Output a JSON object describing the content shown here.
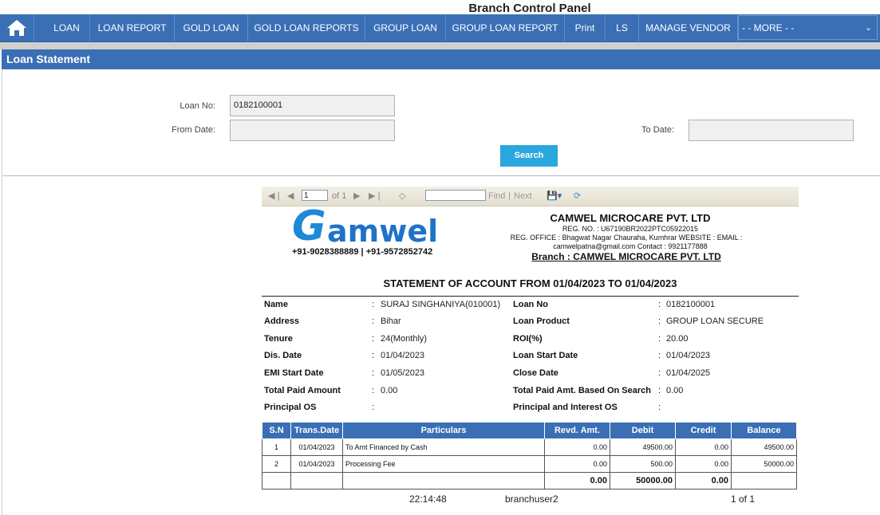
{
  "app": {
    "title": "Branch Control Panel"
  },
  "nav": {
    "items": [
      "LOAN",
      "LOAN REPORT",
      "GOLD LOAN",
      "GOLD LOAN REPORTS",
      "GROUP LOAN",
      "GROUP LOAN REPORT",
      "Print",
      "LS",
      "MANAGE VENDOR"
    ],
    "more": "- - MORE - -"
  },
  "section": {
    "title": "Loan Statement"
  },
  "form": {
    "loan_no_label": "Loan No:",
    "loan_no_value": "0182100001",
    "from_date_label": "From Date:",
    "to_date_label": "To Date:",
    "search_label": "Search"
  },
  "toolbar": {
    "page_value": "1",
    "of_label": "of 1",
    "find_label": "Find",
    "separator": "|",
    "next_label": "Next"
  },
  "report": {
    "logo_initial": "G",
    "logo_rest": "amwel",
    "logo_phone": "+91-9028388889 | +91-9572852742",
    "company": "CAMWEL MICROCARE PVT. LTD",
    "reg_no": "REG. NO. : U67190BR2022PTC05922015",
    "reg_office": "REG. OFFICE : Bhagwat Nagar Chauraha,  Kumhrar WEBSITE :       EMAIL :",
    "email_contact": "camwelpatna@gmail.com     Contact : 9921177888",
    "branch": "Branch : CAMWEL MICROCARE PVT. LTD",
    "statement_title": "STATEMENT OF ACCOUNT FROM 01/04/2023 TO  01/04/2023",
    "info_left": [
      {
        "label": "Name",
        "value": "SURAJ  SINGHANIYA(010001)"
      },
      {
        "label": "Address",
        "value": "Bihar"
      },
      {
        "label": "Tenure",
        "value": "24(Monthly)"
      },
      {
        "label": "Dis. Date",
        "value": "01/04/2023"
      },
      {
        "label": "EMI Start Date",
        "value": "01/05/2023"
      },
      {
        "label": "Total Paid Amount",
        "value": "0.00"
      },
      {
        "label": "Principal OS",
        "value": ""
      }
    ],
    "info_right": [
      {
        "label": "Loan No",
        "value": "0182100001"
      },
      {
        "label": "Loan Product",
        "value": "GROUP LOAN SECURE"
      },
      {
        "label": "ROI(%)",
        "value": "20.00"
      },
      {
        "label": "Loan Start Date",
        "value": "01/04/2023"
      },
      {
        "label": "Close Date",
        "value": "01/04/2025"
      },
      {
        "label": "Total Paid Amt. Based On Search",
        "value": "0.00"
      },
      {
        "label": "Principal and Interest OS",
        "value": ""
      }
    ],
    "colon": ":",
    "table": {
      "headers": [
        "S.N",
        "Trans.Date",
        "Particulars",
        "Revd. Amt.",
        "Debit",
        "Credit",
        "Balance"
      ],
      "rows": [
        [
          "1",
          "01/04/2023",
          "To Amt Financed by Cash",
          "0.00",
          "49500.00",
          "0.00",
          "49500.00"
        ],
        [
          "2",
          "01/04/2023",
          "Processing Fee",
          "0.00",
          "500.00",
          "0.00",
          "50000.00"
        ]
      ],
      "totals": [
        "",
        "",
        "",
        "0.00",
        "50000.00",
        "0.00",
        ""
      ]
    },
    "footer_time": "22:14:48",
    "footer_user": "branchuser2",
    "footer_page": "1 of 1"
  }
}
